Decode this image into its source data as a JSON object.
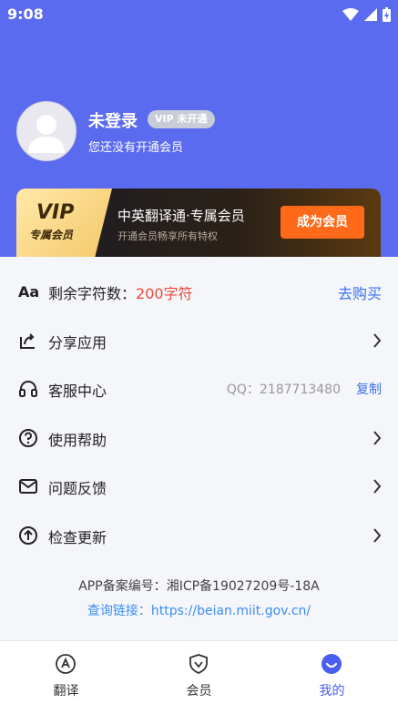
{
  "status": {
    "time": "9:08"
  },
  "profile": {
    "name": "未登录",
    "vip_chip": "VIP 未开通",
    "subtitle": "您还没有开通会员"
  },
  "vip_banner": {
    "badge_big": "VIP",
    "badge_small": "专属会员",
    "title": "中英翻译通·专属会员",
    "desc": "开通会员畅享所有特权",
    "button": "成为会员"
  },
  "menu": {
    "char_count_label": "剩余字符数：",
    "char_count_value": "200字符",
    "buy_label": "去购买",
    "share": "分享应用",
    "service": "客服中心",
    "qq": "QQ：2187713480",
    "copy": "复制",
    "help": "使用帮助",
    "feedback": "问题反馈",
    "update": "检查更新"
  },
  "footer": {
    "icp": "APP备案编号：湘ICP备19027209号-18A",
    "query": "查询链接：https://beian.miit.gov.cn/"
  },
  "tabs": [
    {
      "label": "翻译",
      "icon": "translate-icon"
    },
    {
      "label": "会员",
      "icon": "vip-shield-icon"
    },
    {
      "label": "我的",
      "icon": "smile-icon"
    }
  ],
  "colors": {
    "header": "#5b6bf0",
    "accent_red": "#e84a3c",
    "link_blue": "#3b6ef0",
    "vip_orange": "#ff6a1a",
    "active_tab": "#4a5ef0"
  }
}
